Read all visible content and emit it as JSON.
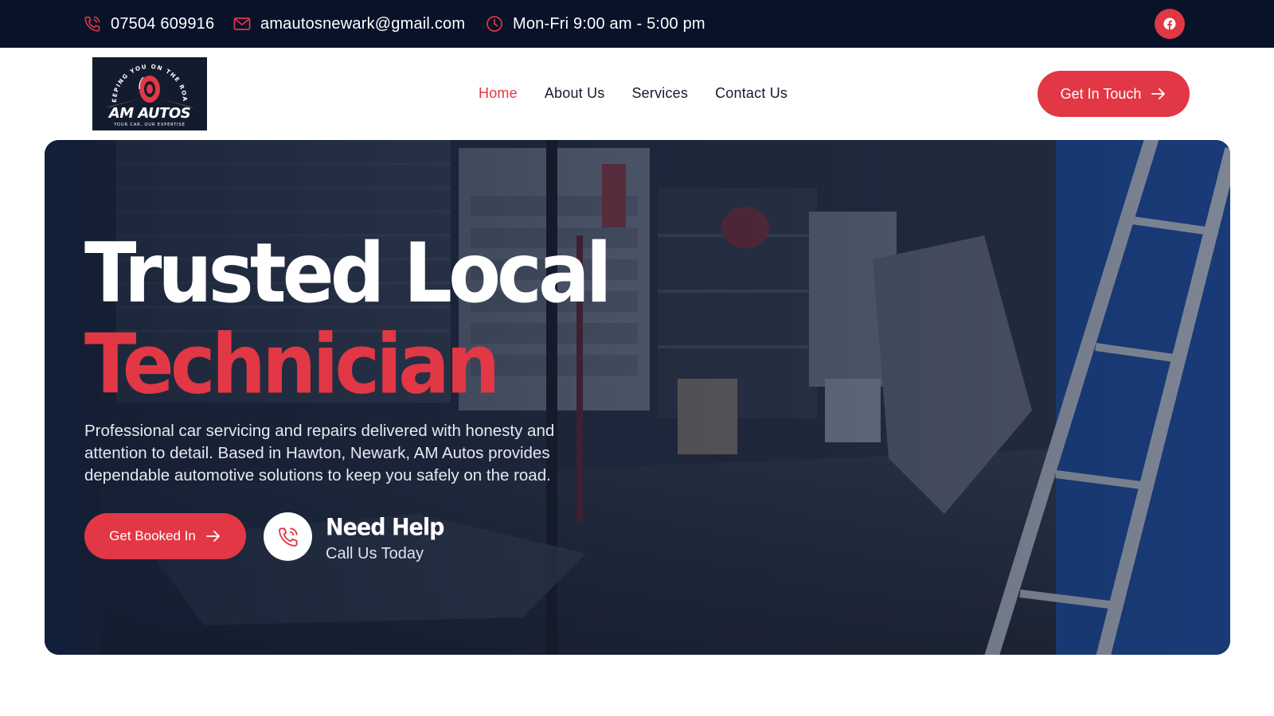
{
  "topbar": {
    "phone": "07504 609916",
    "email": "amautosnewark@gmail.com",
    "hours": "Mon-Fri 9:00 am - 5:00 pm",
    "social_icon": "facebook-icon"
  },
  "logo": {
    "arc_text": "KEEPING YOU ON THE ROAD",
    "name": "AM AUTOS",
    "tagline": "YOUR CAR, OUR EXPERTISE"
  },
  "nav": {
    "items": [
      {
        "label": "Home",
        "active": true
      },
      {
        "label": "About Us",
        "active": false
      },
      {
        "label": "Services",
        "active": false
      },
      {
        "label": "Contact Us",
        "active": false
      }
    ]
  },
  "header": {
    "cta_label": "Get In Touch"
  },
  "hero": {
    "title_line1": "Trusted Local",
    "title_line2": "Technician",
    "description": "Professional car servicing and repairs delivered with honesty and attention to detail. Based in Hawton, Newark, AM Autos provides dependable automotive solutions to keep you safely on the road.",
    "book_label": "Get Booked In",
    "help_title": "Need Help",
    "help_subtitle": "Call Us Today"
  },
  "colors": {
    "accent": "#e23744",
    "topbar_bg": "#08132a",
    "text_dark": "#111a2e"
  }
}
